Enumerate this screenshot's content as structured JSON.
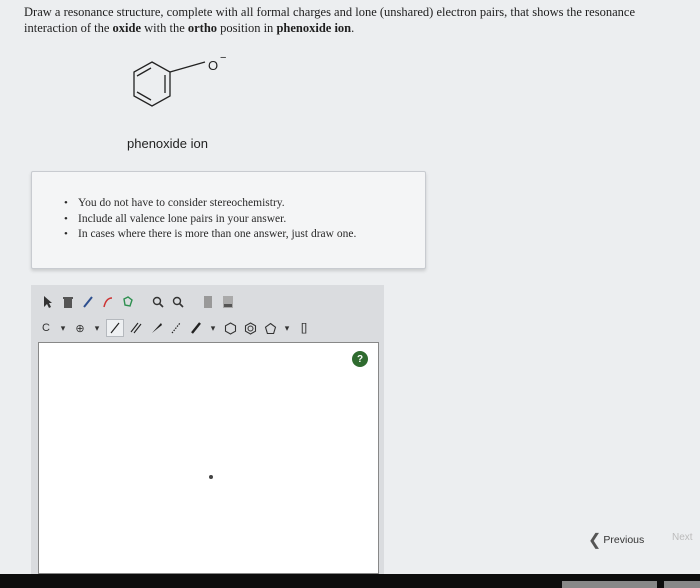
{
  "question": {
    "part1": "Draw a resonance structure, complete with all formal charges and lone (unshared) electron pairs, that shows the resonance interaction of the ",
    "bold1": "oxide",
    "part2": " with the ",
    "bold2": "ortho",
    "part3": " position in ",
    "bold3": "phenoxide ion",
    "part4": "."
  },
  "molecule": {
    "oxygen_label": "O",
    "charge_label": "−",
    "caption": "phenoxide ion"
  },
  "instructions": [
    "You do not have to consider stereochemistry.",
    "Include all valence lone pairs in your answer.",
    "In cases where there is more than one answer, just draw one."
  ],
  "toolbar": {
    "element_label": "C",
    "charge_label": "⊕",
    "bracket_label": "[]"
  },
  "help_label": "?",
  "nav": {
    "previous_label": "Previous",
    "next_label": "Next"
  },
  "colors": {
    "help_icon": "#2f6b2f",
    "background": "#eceef0"
  }
}
